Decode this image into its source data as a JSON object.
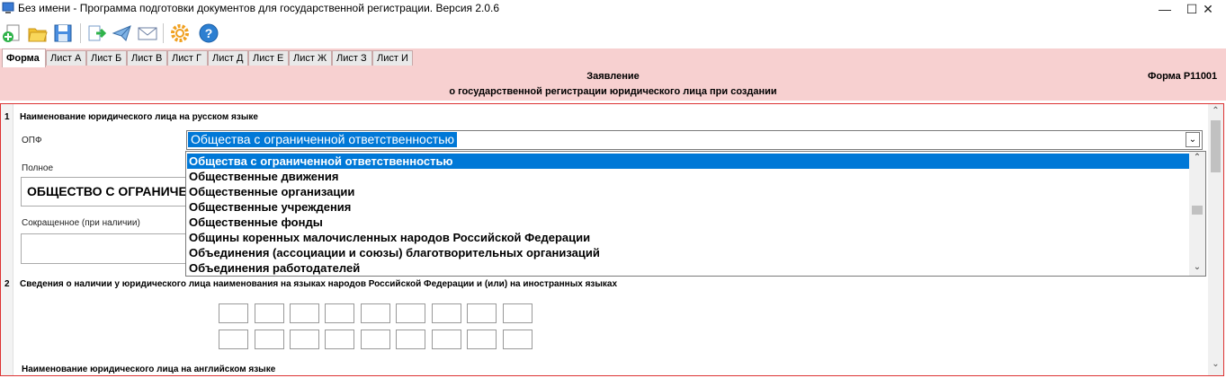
{
  "window": {
    "title": "Без имени - Программа подготовки документов для государственной регистрации. Версия 2.0.6",
    "minimize": "—",
    "maximize": "☐",
    "close": "✕"
  },
  "toolbar": {
    "icons": [
      "new-document-icon",
      "open-folder-icon",
      "save-icon",
      "export-icon",
      "send-icon",
      "mail-icon",
      "settings-icon",
      "help-icon"
    ]
  },
  "tabs": [
    {
      "label": "Форма",
      "active": true
    },
    {
      "label": "Лист А"
    },
    {
      "label": "Лист Б"
    },
    {
      "label": "Лист В"
    },
    {
      "label": "Лист Г"
    },
    {
      "label": "Лист Д"
    },
    {
      "label": "Лист Е"
    },
    {
      "label": "Лист Ж"
    },
    {
      "label": "Лист З"
    },
    {
      "label": "Лист И"
    }
  ],
  "header": {
    "title": "Заявление",
    "subtitle": "о государственной регистрации юридического лица при создании",
    "form_code": "Форма Р11001"
  },
  "section1": {
    "number": "1",
    "title": "Наименование юридического лица на русском языке",
    "opf_label": "ОПФ",
    "full_label": "Полное",
    "full_value": "ОБЩЕСТВО С ОГРАНИЧЕ",
    "short_label": "Сокращенное (при наличии)",
    "short_value": ""
  },
  "combo": {
    "selected": "Общества с ограниченной ответственностью",
    "options": [
      "Общества с ограниченной ответственностью",
      "Общественные движения",
      "Общественные организации",
      "Общественные учреждения",
      "Общественные фонды",
      "Общины коренных малочисленных народов Российской Федерации",
      "Объединения (ассоциации и союзы) благотворительных организаций",
      "Объединения работодателей"
    ],
    "selected_index": 0
  },
  "section2": {
    "number": "2",
    "title": "Сведения о наличии у юридического лица наименования на языках народов Российской Федерации и (или) на иностранных языках",
    "english_label": "Наименование юридического лица на английском языке"
  },
  "colors": {
    "accent": "#0078d7",
    "header_bg": "#f7d0d0",
    "frame_border": "#dd3333"
  }
}
